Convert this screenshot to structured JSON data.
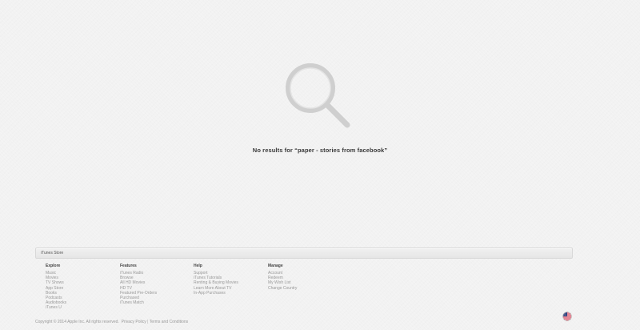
{
  "search": {
    "no_results_prefix": "No results for ",
    "query": "“paper - stories from facebook”"
  },
  "footer": {
    "bar_title": "iTunes Store",
    "columns": [
      {
        "heading": "Explore",
        "links": [
          "Music",
          "Movies",
          "TV Shows",
          "App Store",
          "Books",
          "Podcasts",
          "Audiobooks",
          "iTunes U"
        ]
      },
      {
        "heading": "Features",
        "links": [
          "iTunes Radio",
          "Browse",
          "All HD Movies",
          "HD TV",
          "Featured Pre-Orders",
          "Purchased",
          "iTunes Match"
        ]
      },
      {
        "heading": "Help",
        "links": [
          "Support",
          "iTunes Tutorials",
          "Renting & Buying Movies",
          "Learn More About TV",
          "In-App Purchases"
        ]
      },
      {
        "heading": "Manage",
        "links": [
          "Account",
          "Redeem",
          "My Wish List",
          "Change Country"
        ]
      }
    ],
    "copyright": "Copyright © 2014 Apple Inc. All rights reserved.",
    "privacy_link": "Privacy Policy",
    "separator": "|",
    "terms_link": "Terms and Conditions",
    "country_flag_icon": "us-flag-icon"
  },
  "colors": {
    "background": "#f2f2f2",
    "magnifier": "#d4d4d4",
    "link_gray": "#999999",
    "heading_dark": "#444444"
  }
}
